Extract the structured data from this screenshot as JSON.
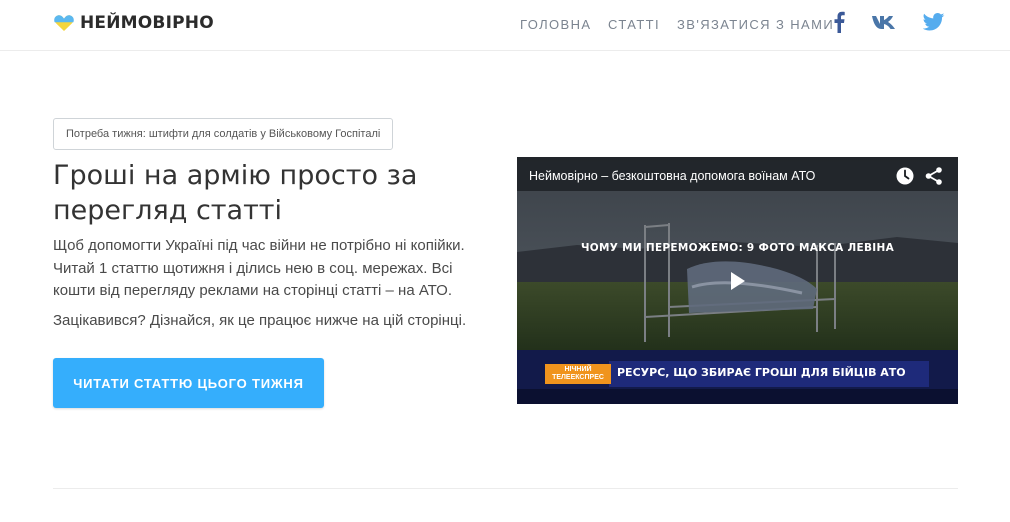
{
  "brand": {
    "name": "НЕЙМОВІРНО"
  },
  "nav": {
    "items": [
      {
        "label": "ГОЛОВНА"
      },
      {
        "label": "СТАТТІ"
      },
      {
        "label": "ЗВ'ЯЗАТИСЯ З НАМИ"
      }
    ],
    "social": [
      "facebook-icon",
      "vk-icon",
      "twitter-icon"
    ]
  },
  "hero": {
    "badge": "Потреба тижня: штифти для солдатів у Військовому Госпіталі",
    "title": "Гроші на армію просто за перегляд статті",
    "description": "Щоб допомогти Україні під час війни не потрібно ні копійки. Читай 1 статтю щотижня і ділись нею в соц. мережах. Всі кошти від перегляду реклами на сторінці статті – на АТО.",
    "note": "Зацікавився? Дізнайся, як це працює нижче на цій сторінці.",
    "cta_label": "ЧИТАТИ СТАТТЮ ЦЬОГО ТИЖНЯ"
  },
  "video": {
    "title": "Неймовірно – безкоштовна допомога воїнам АТО",
    "caption": "ЧОМУ МИ ПЕРЕМОЖЕМО: 9 ФОТО МАКСА ЛЕВІНА",
    "badge_line1": "НІЧНИЙ",
    "badge_line2": "ТЕЛЕЕКСПРЕС",
    "ticker": "РЕСУРС, ЩО ЗБИРАЄ ГРОШІ ДЛЯ БІЙЦІВ АТО"
  },
  "colors": {
    "accent": "#35aefc",
    "nav_text": "#7b8490",
    "facebook": "#3b5998",
    "vk": "#4a76a8",
    "twitter": "#55acee",
    "heart_top": "#5bb8f0",
    "heart_bottom": "#f5d63d"
  }
}
